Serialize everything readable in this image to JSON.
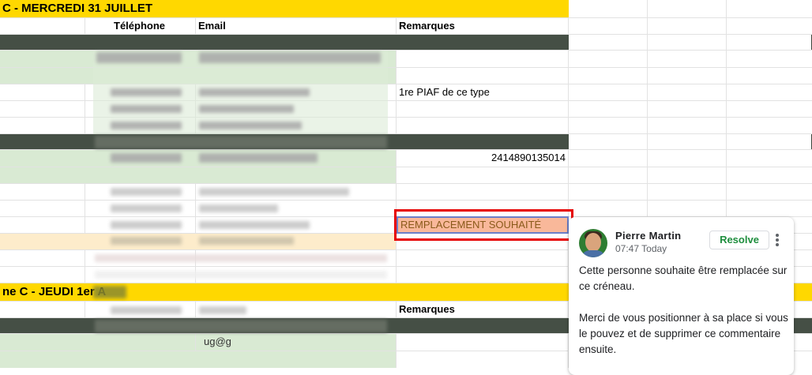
{
  "sections": {
    "first_banner": "C - MERCREDI 31 JUILLET",
    "second_banner": "ne C - JEUDI 1er A"
  },
  "headers": {
    "telephone": "Téléphone",
    "email": "Email",
    "remarques": "Remarques",
    "remarques_2": "Remarques"
  },
  "cells": {
    "remark_piaf": "1re PIAF de ce type",
    "number_value": "2414890135014",
    "selected_cell": "REMPLACEMENT SOUHAITÉ",
    "partial_email": "ug@g"
  },
  "comment": {
    "author": "Pierre Martin",
    "time": "07:47 Today",
    "resolve_label": "Resolve",
    "paragraph_1": "Cette personne souhaite être remplacée sur ce créneau.",
    "paragraph_2": "Merci de vous positionner à sa place si vous le pouvez et de supprimer ce commentaire ensuite."
  },
  "colors": {
    "banner": "#ffd800",
    "dark_row": "#454f45",
    "green_row": "#d9ead3",
    "peach_row": "#fdeccb",
    "selection_border": "#e60000",
    "resolve_text": "#1e8e3e"
  },
  "icons": {
    "more": "more-vert-icon",
    "avatar": "user-avatar"
  }
}
